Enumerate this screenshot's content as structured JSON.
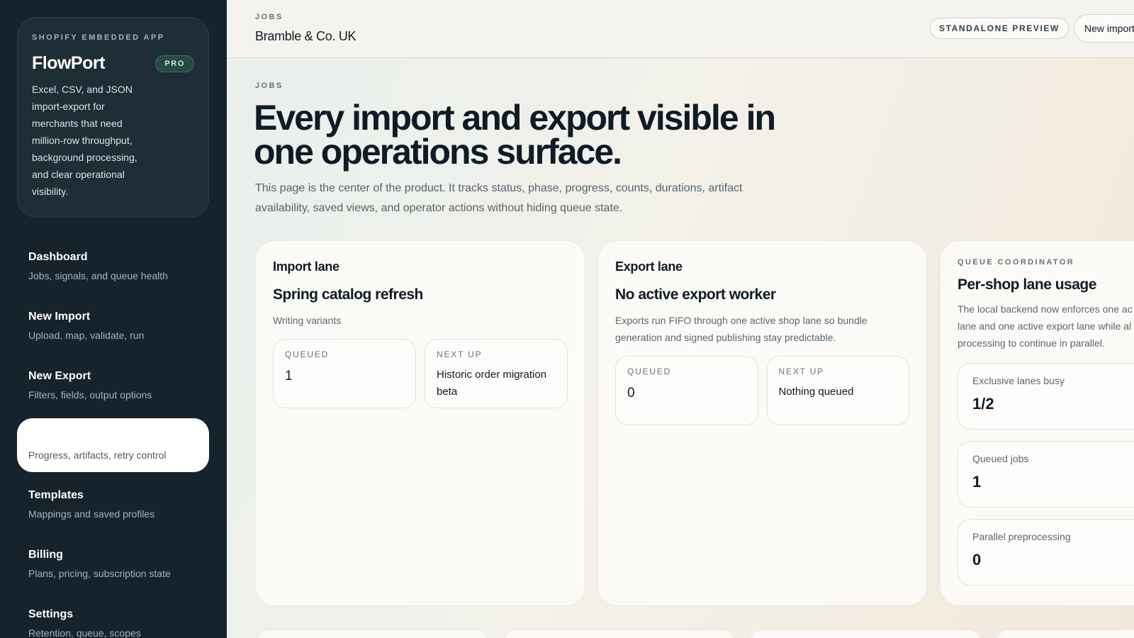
{
  "sidebar": {
    "eyebrow": "SHOPIFY EMBEDDED APP",
    "app_name": "FlowPort",
    "badge": "PRO",
    "description": "Excel, CSV, and JSON import-export for merchants that need million-row throughput, background processing, and clear operational visibility.",
    "items": [
      {
        "title": "Dashboard",
        "sub": "Jobs, signals, and queue health"
      },
      {
        "title": "New Import",
        "sub": "Upload, map, validate, run"
      },
      {
        "title": "New Export",
        "sub": "Filters, fields, output options"
      },
      {
        "title": "",
        "sub": "Progress, artifacts, retry control"
      },
      {
        "title": "Templates",
        "sub": "Mappings and saved profiles"
      },
      {
        "title": "Billing",
        "sub": "Plans, pricing, subscription state"
      },
      {
        "title": "Settings",
        "sub": "Retention, queue, scopes"
      }
    ]
  },
  "topbar": {
    "eyebrow": "JOBS",
    "shop": "Bramble & Co. UK",
    "preview_label": "STANDALONE PREVIEW",
    "new_import_label": "New import"
  },
  "main": {
    "eyebrow": "JOBS",
    "title": "Every import and export visible in one operations surface.",
    "description": "This page is the center of the product. It tracks status, phase, progress, counts, durations, artifact availability, saved views, and operator actions without hiding queue state.",
    "import_lane": {
      "kicker": "Import lane",
      "title": "Spring catalog refresh",
      "sub": "Writing variants",
      "queued_label": "QUEUED",
      "queued_value": "1",
      "next_label": "NEXT UP",
      "next_value": "Historic order migration beta"
    },
    "export_lane": {
      "kicker": "Export lane",
      "title": "No active export worker",
      "sub": "Exports run FIFO through one active shop lane so bundle generation and signed publishing stay predictable.",
      "queued_label": "QUEUED",
      "queued_value": "0",
      "next_label": "NEXT UP",
      "next_value": "Nothing queued"
    },
    "queue_coordinator": {
      "eyebrow": "QUEUE COORDINATOR",
      "title": "Per-shop lane usage",
      "desc_lines": [
        "The local backend now enforces one ac",
        "lane and one active export lane while al",
        "processing to continue in parallel."
      ],
      "metrics": [
        {
          "label": "Exclusive lanes busy",
          "value": "1/2"
        },
        {
          "label": "Queued jobs",
          "value": "1"
        },
        {
          "label": "Parallel preprocessing",
          "value": "0"
        }
      ]
    }
  }
}
